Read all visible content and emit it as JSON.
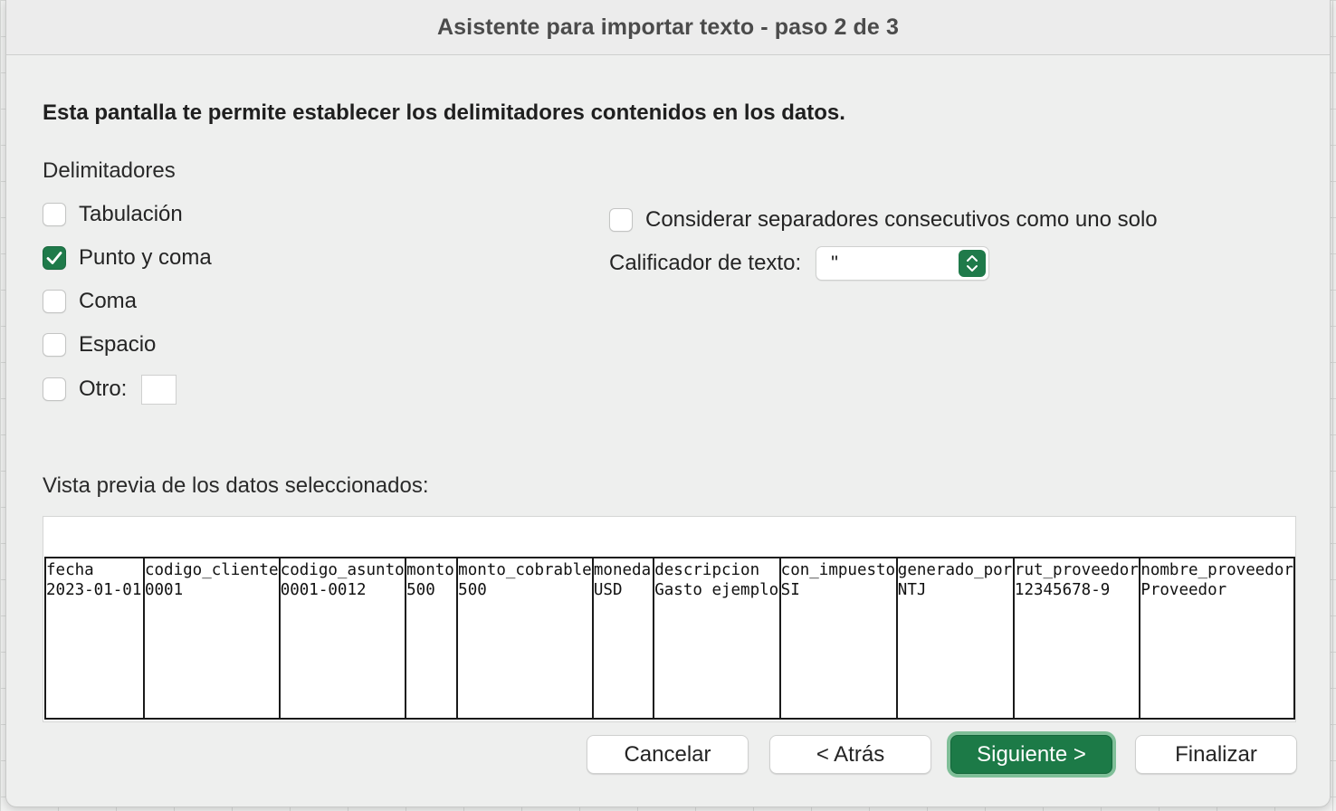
{
  "window": {
    "title": "Asistente para importar texto - paso 2 de 3"
  },
  "heading": "Esta pantalla te permite establecer los delimitadores contenidos en los datos.",
  "delimiters": {
    "label": "Delimitadores",
    "items": [
      {
        "label": "Tabulación",
        "checked": false
      },
      {
        "label": "Punto y coma",
        "checked": true
      },
      {
        "label": "Coma",
        "checked": false
      },
      {
        "label": "Espacio",
        "checked": false
      },
      {
        "label": "Otro:",
        "checked": false
      }
    ],
    "other_value": ""
  },
  "consecutive": {
    "label": "Considerar separadores consecutivos como uno solo",
    "checked": false
  },
  "qualifier": {
    "label": "Calificador de texto:",
    "value": "\""
  },
  "preview": {
    "label": "Vista previa de los datos seleccionados:",
    "columns": [
      {
        "header": "fecha",
        "value": "2023-01-01"
      },
      {
        "header": "codigo_cliente",
        "value": "0001"
      },
      {
        "header": "codigo_asunto",
        "value": "0001-0012"
      },
      {
        "header": "monto",
        "value": "500"
      },
      {
        "header": "monto_cobrable",
        "value": "500"
      },
      {
        "header": "moneda",
        "value": "USD"
      },
      {
        "header": "descripcion",
        "value": "Gasto ejemplo"
      },
      {
        "header": "con_impuesto",
        "value": "SI"
      },
      {
        "header": "generado_por",
        "value": "NTJ"
      },
      {
        "header": "rut_proveedor",
        "value": "12345678-9"
      },
      {
        "header": "nombre_proveedor",
        "value": "Proveedor"
      }
    ]
  },
  "buttons": {
    "cancel": "Cancelar",
    "back": "< Atrás",
    "next": "Siguiente >",
    "finish": "Finalizar"
  },
  "colors": {
    "accent": "#1c7a47",
    "focus_ring": "#7fbf98"
  }
}
